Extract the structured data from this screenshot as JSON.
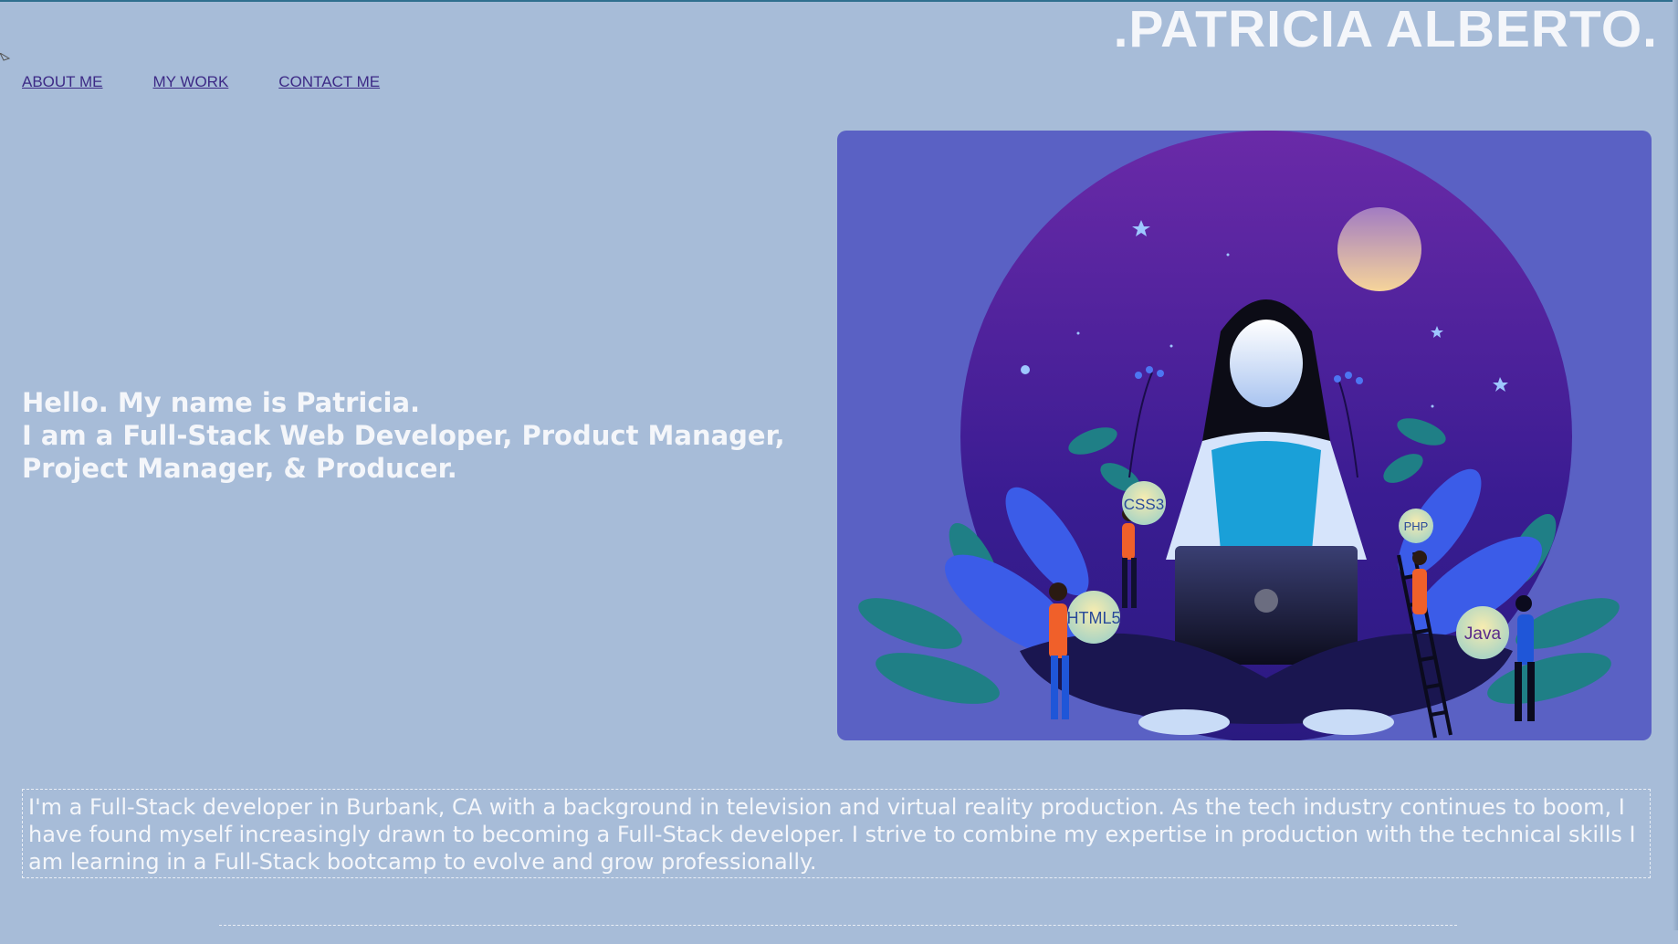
{
  "header": {
    "title": ".PATRICIA ALBERTO."
  },
  "nav": {
    "items": [
      {
        "label": "ABOUT ME"
      },
      {
        "label": "MY WORK"
      },
      {
        "label": "CONTACT ME"
      }
    ]
  },
  "intro": {
    "line1": "Hello. My name is Patricia.",
    "line2": "I am a Full-Stack Web Developer, Product Manager, Project Manager, & Producer."
  },
  "hero": {
    "badges": [
      "CSS3",
      "PHP",
      "HTML5",
      "Java"
    ]
  },
  "about": {
    "text": "I'm a Full-Stack developer in Burbank, CA with a background in television and virtual reality production. As the tech industry continues to boom, I have found myself increasingly drawn to becoming a Full-Stack developer. I strive to combine my expertise in production with the technical skills I am learning in a Full-Stack bootcamp to evolve and grow professionally."
  },
  "colors": {
    "page_background": "#a7bcd8",
    "title_text": "#f4f6fa",
    "nav_link": "#3d2a86",
    "hero_background": "#5a61c4"
  }
}
